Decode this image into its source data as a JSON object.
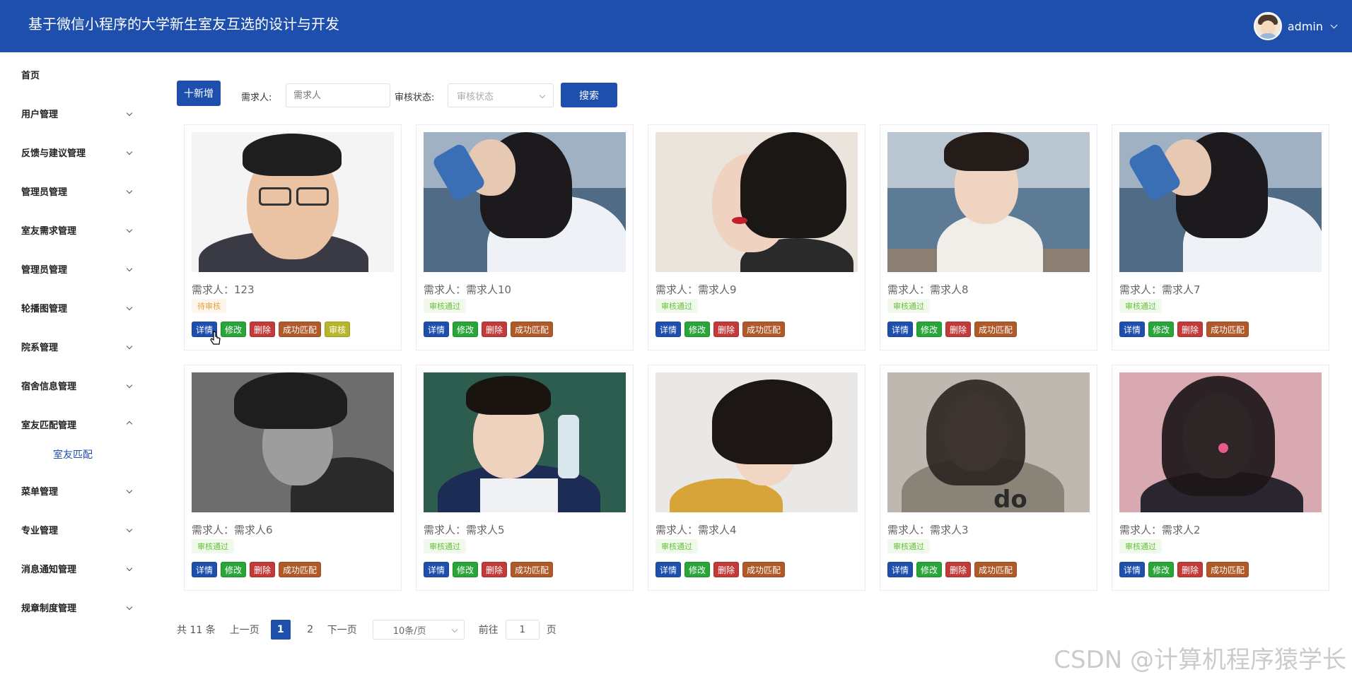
{
  "header": {
    "title": "基于微信小程序的大学新生室友互选的设计与开发",
    "username": "admin"
  },
  "sidebar": {
    "items": [
      {
        "label": "首页",
        "has_children": false
      },
      {
        "label": "用户管理",
        "has_children": true
      },
      {
        "label": "反馈与建议管理",
        "has_children": true
      },
      {
        "label": "管理员管理",
        "has_children": true
      },
      {
        "label": "室友需求管理",
        "has_children": true
      },
      {
        "label": "管理员管理",
        "has_children": true
      },
      {
        "label": "轮播图管理",
        "has_children": true
      },
      {
        "label": "院系管理",
        "has_children": true
      },
      {
        "label": "宿舍信息管理",
        "has_children": true
      },
      {
        "label": "室友匹配管理",
        "has_children": true,
        "expanded": true
      },
      {
        "label": "菜单管理",
        "has_children": true
      },
      {
        "label": "专业管理",
        "has_children": true
      },
      {
        "label": "消息通知管理",
        "has_children": true
      },
      {
        "label": "规章制度管理",
        "has_children": true
      }
    ],
    "sub_item": "室友匹配"
  },
  "toolbar": {
    "add_label": "十新增",
    "requester_label": "需求人:",
    "requester_placeholder": "需求人",
    "status_label": "审核状态:",
    "status_placeholder": "审核状态",
    "search_label": "搜索"
  },
  "cards": [
    {
      "requester": "需求人：123",
      "status": "待审核",
      "status_type": "pending",
      "actions": [
        "详情",
        "修改",
        "删除",
        "成功匹配",
        "审核"
      ]
    },
    {
      "requester": "需求人：需求人10",
      "status": "审核通过",
      "status_type": "approved",
      "actions": [
        "详情",
        "修改",
        "删除",
        "成功匹配"
      ]
    },
    {
      "requester": "需求人：需求人9",
      "status": "审核通过",
      "status_type": "approved",
      "actions": [
        "详情",
        "修改",
        "删除",
        "成功匹配"
      ]
    },
    {
      "requester": "需求人：需求人8",
      "status": "审核通过",
      "status_type": "approved",
      "actions": [
        "详情",
        "修改",
        "删除",
        "成功匹配"
      ]
    },
    {
      "requester": "需求人：需求人7",
      "status": "审核通过",
      "status_type": "approved",
      "actions": [
        "详情",
        "修改",
        "删除",
        "成功匹配"
      ]
    },
    {
      "requester": "需求人：需求人6",
      "status": "审核通过",
      "status_type": "approved",
      "actions": [
        "详情",
        "修改",
        "删除",
        "成功匹配"
      ]
    },
    {
      "requester": "需求人：需求人5",
      "status": "审核通过",
      "status_type": "approved",
      "actions": [
        "详情",
        "修改",
        "删除",
        "成功匹配"
      ]
    },
    {
      "requester": "需求人：需求人4",
      "status": "审核通过",
      "status_type": "approved",
      "actions": [
        "详情",
        "修改",
        "删除",
        "成功匹配"
      ]
    },
    {
      "requester": "需求人：需求人3",
      "status": "审核通过",
      "status_type": "approved",
      "actions": [
        "详情",
        "修改",
        "删除",
        "成功匹配"
      ]
    },
    {
      "requester": "需求人：需求人2",
      "status": "审核通过",
      "status_type": "approved",
      "actions": [
        "详情",
        "修改",
        "删除",
        "成功匹配"
      ]
    }
  ],
  "pagination": {
    "total": "共 11 条",
    "prev": "上一页",
    "pages": [
      "1",
      "2"
    ],
    "current": "1",
    "next": "下一页",
    "page_size": "10条/页",
    "goto_label": "前往",
    "goto_value": "1",
    "page_suffix": "页"
  },
  "watermark": "CSDN @计算机程序猿学长",
  "colors": {
    "primary": "#1f4fad",
    "edit": "#2aa53a",
    "delete": "#c33a3a",
    "match": "#b05a2a",
    "audit": "#b8b52a"
  }
}
